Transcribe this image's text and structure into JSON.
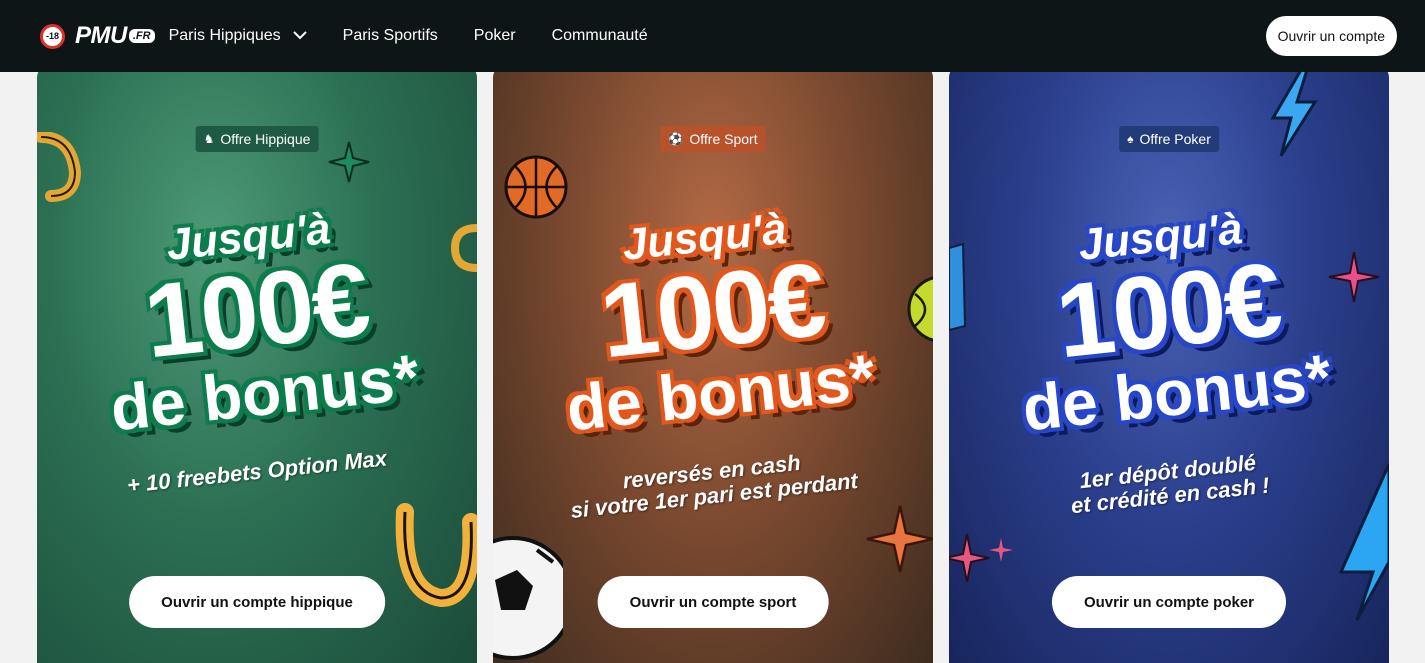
{
  "header": {
    "age_label": "-18",
    "logo": "PMU",
    "logo_tag": ".FR",
    "nav": [
      {
        "label": "Paris Hippiques",
        "has_dropdown": true
      },
      {
        "label": "Paris Sportifs"
      },
      {
        "label": "Poker"
      },
      {
        "label": "Communauté"
      }
    ],
    "cta": "Ouvrir un compte"
  },
  "cards": [
    {
      "tag": "Offre Hippique",
      "line1": "Jusqu'à",
      "amount": "100€",
      "line3": "de bonus*",
      "sub": "+ 10 freebets Option Max",
      "button": "Ouvrir un compte hippique",
      "accent": "#0e7d4e"
    },
    {
      "tag": "Offre Sport",
      "line1": "Jusqu'à",
      "amount": "100€",
      "line3": "de bonus*",
      "sub": "reversés en cash",
      "sub2": "si votre 1er pari est perdant",
      "button": "Ouvrir un compte sport",
      "accent": "#e2571b"
    },
    {
      "tag": "Offre Poker",
      "line1": "Jusqu'à",
      "amount": "100€",
      "line3": "de bonus*",
      "sub": "1er dépôt doublé",
      "sub2": "et crédité en cash !",
      "button": "Ouvrir un compte poker",
      "accent": "#2747c8"
    }
  ]
}
